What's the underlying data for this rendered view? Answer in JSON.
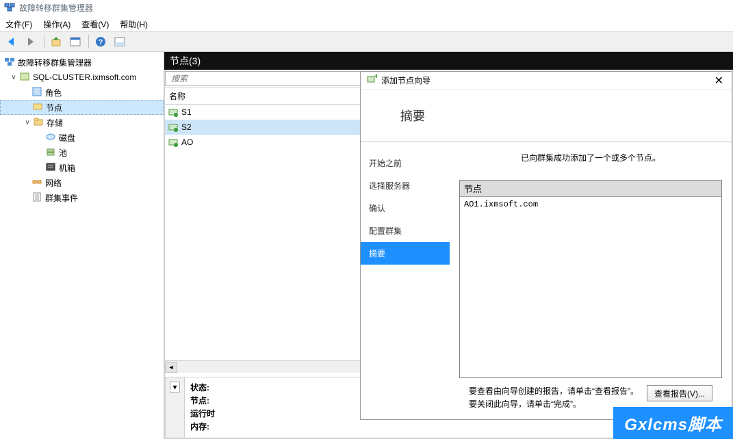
{
  "window": {
    "title": "故障转移群集管理器"
  },
  "menu": {
    "file": "文件(F)",
    "action": "操作(A)",
    "view": "查看(V)",
    "help": "帮助(H)"
  },
  "tree": {
    "root": "故障转移群集管理器",
    "cluster": "SQL-CLUSTER.ixmsoft.com",
    "roles": "角色",
    "nodes": "节点",
    "storage": "存储",
    "disks": "磁盘",
    "pools": "池",
    "chassis": "机箱",
    "networks": "网络",
    "events": "群集事件"
  },
  "center": {
    "header": "节点(3)",
    "search_placeholder": "搜索",
    "col_name": "名称",
    "rows": [
      "S1",
      "S2",
      "AO"
    ]
  },
  "lower": {
    "collapse_glyph": "▾",
    "status": "状态:",
    "nodes": "节点:",
    "running": "运行时",
    "memory": "内存:"
  },
  "wizard": {
    "title": "添加节点向导",
    "page_title": "摘要",
    "steps": [
      "开始之前",
      "选择服务器",
      "确认",
      "配置群集",
      "摘要"
    ],
    "active_step_index": 4,
    "message": "已向群集成功添加了一个或多个节点。",
    "result_header": "节点",
    "result_body": "AO1.ixmsoft.com",
    "hint_line1": "要查看由向导创建的报告，请单击“查看报告”。",
    "hint_line2": "要关闭此向导，请单击“完成”。",
    "view_report_btn": "查看报告(V)..."
  },
  "watermark": "Gxlcms脚本"
}
